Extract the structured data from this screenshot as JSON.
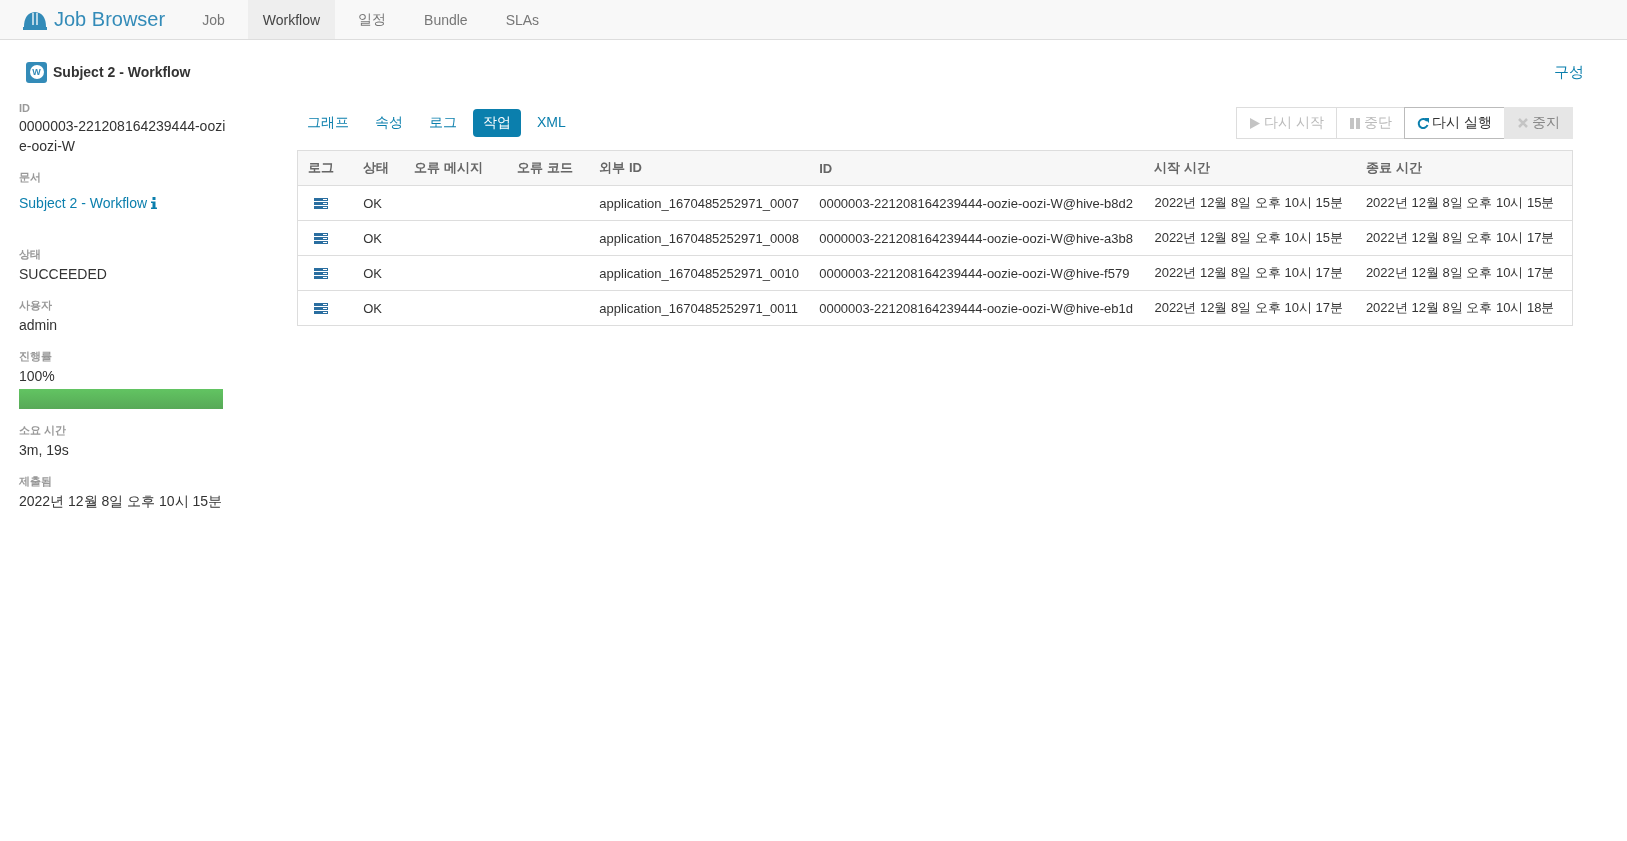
{
  "nav": {
    "brand": "Job Browser",
    "tabs": [
      {
        "label": "Job",
        "selected": false
      },
      {
        "label": "Workflow",
        "selected": true
      },
      {
        "label": "일정",
        "selected": false
      },
      {
        "label": "Bundle",
        "selected": false
      },
      {
        "label": "SLAs",
        "selected": false
      }
    ]
  },
  "header": {
    "title": "Subject 2 - Workflow",
    "badge": "W",
    "config_link": "구성"
  },
  "sidebar": [
    {
      "kind": "text",
      "label": "ID",
      "value": "0000003-221208164239444-oozie-oozi-W"
    },
    {
      "kind": "link",
      "label": "문서",
      "value": "Subject 2 - Workflow"
    },
    {
      "kind": "text",
      "label": "상태",
      "value": "SUCCEEDED"
    },
    {
      "kind": "text",
      "label": "사용자",
      "value": "admin"
    },
    {
      "kind": "progress",
      "label": "진행률",
      "value": "100%",
      "level": 1
    },
    {
      "kind": "text",
      "label": "소요 시간",
      "value": "3m, 19s"
    },
    {
      "kind": "text",
      "label": "제출됨",
      "value": "2022년 12월 8일 오후 10시 15분"
    }
  ],
  "tabs": [
    {
      "label": "그래프",
      "selected": false
    },
    {
      "label": "속성",
      "selected": false
    },
    {
      "label": "로그",
      "selected": false
    },
    {
      "label": "작업",
      "selected": true
    },
    {
      "label": "XML",
      "selected": false
    }
  ],
  "buttons": [
    {
      "kind": "play",
      "label": "다시 시작",
      "disabled": true
    },
    {
      "kind": "pause",
      "label": "중단",
      "disabled": true
    },
    {
      "kind": "refresh",
      "label": "다시 실행",
      "disabled": false
    },
    {
      "kind": "stop",
      "label": "중지",
      "disabled": true
    }
  ],
  "table": {
    "columns": [
      "로그",
      "상태",
      "오류 메시지",
      "오류 코드",
      "외부 ID",
      "ID",
      "시작 시간",
      "종료 시간"
    ],
    "rows": [
      {
        "status": "OK",
        "external_id": "application_1670485252971_0007",
        "id": "0000003-221208164239444-oozie-oozi-W@hive-b8d2",
        "start": "2022년 12월 8일 오후 10시 15분",
        "end": "2022년 12월 8일 오후 10시 15분"
      },
      {
        "status": "OK",
        "external_id": "application_1670485252971_0008",
        "id": "0000003-221208164239444-oozie-oozi-W@hive-a3b8",
        "start": "2022년 12월 8일 오후 10시 15분",
        "end": "2022년 12월 8일 오후 10시 17분"
      },
      {
        "status": "OK",
        "external_id": "application_1670485252971_0010",
        "id": "0000003-221208164239444-oozie-oozi-W@hive-f579",
        "start": "2022년 12월 8일 오후 10시 17분",
        "end": "2022년 12월 8일 오후 10시 17분"
      },
      {
        "status": "OK",
        "external_id": "application_1670485252971_0011",
        "id": "0000003-221208164239444-oozie-oozi-W@hive-eb1d",
        "start": "2022년 12월 8일 오후 10시 17분",
        "end": "2022년 12월 8일 오후 10시 18분"
      }
    ]
  }
}
